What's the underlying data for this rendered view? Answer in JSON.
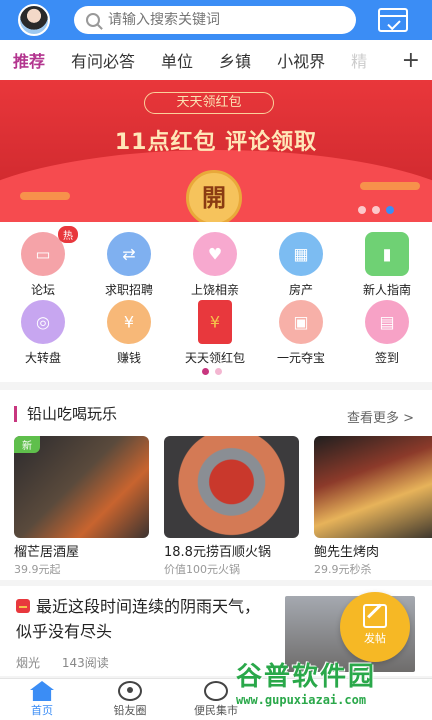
{
  "search": {
    "placeholder": "请输入搜索关键词"
  },
  "tabs": [
    {
      "label": "推荐"
    },
    {
      "label": "有问必答"
    },
    {
      "label": "单位"
    },
    {
      "label": "乡镇"
    },
    {
      "label": "小视界"
    },
    {
      "label": "精"
    }
  ],
  "tab_add": "+",
  "banner": {
    "pill": "天天领红包",
    "headline": "11点红包  评论领取",
    "coin": "開",
    "slides_total": 3,
    "slide_active": 3
  },
  "grid": {
    "items": [
      {
        "label": "论坛",
        "icon": "forum-icon",
        "badge": "热",
        "color": "#f5a3a8"
      },
      {
        "label": "求职招聘",
        "icon": "handshake-icon",
        "color": "#7fb0f0"
      },
      {
        "label": "上饶相亲",
        "icon": "heart-icon",
        "color": "#f7a9cf"
      },
      {
        "label": "房产",
        "icon": "house-icon",
        "color": "#7cbcf2"
      },
      {
        "label": "新人指南",
        "icon": "book-icon",
        "color": "#6fd174"
      },
      {
        "label": "大转盘",
        "icon": "wheel-icon",
        "color": "#c7a6f0"
      },
      {
        "label": "赚钱",
        "icon": "moneybag-icon",
        "color": "#f7b878"
      },
      {
        "label": "天天领红包",
        "icon": "redpacket-icon",
        "color": "#e8383d"
      },
      {
        "label": "一元夺宝",
        "icon": "gift-icon",
        "color": "#f7b0a8"
      },
      {
        "label": "签到",
        "icon": "checkin-icon",
        "color": "#f7a2c6"
      }
    ],
    "pages_total": 2,
    "page_active": 1
  },
  "food": {
    "title": "铅山吃喝玩乐",
    "more": "查看更多 >",
    "cards": [
      {
        "name": "榴芒居酒屋",
        "sub": "39.9元起",
        "tag": "新"
      },
      {
        "name": "18.8元捞百顺火锅",
        "sub": "价值100元火锅"
      },
      {
        "name": "鲍先生烤肉",
        "sub": "29.9元秒杀"
      }
    ]
  },
  "article": {
    "title": "最近这段时间连续的阴雨天气，似乎没有尽头",
    "author": "烟光",
    "reads": "143阅读"
  },
  "post_button": "发帖",
  "bottom_nav": [
    {
      "label": "首页",
      "icon": "home-icon",
      "active": true
    },
    {
      "label": "铅友圈",
      "icon": "eye-icon",
      "active": false
    },
    {
      "label": "便民集市",
      "icon": "grid-icon",
      "active": false
    }
  ],
  "watermark": {
    "brand": "谷普软件园",
    "url": "www.gupuxiazai.com"
  }
}
